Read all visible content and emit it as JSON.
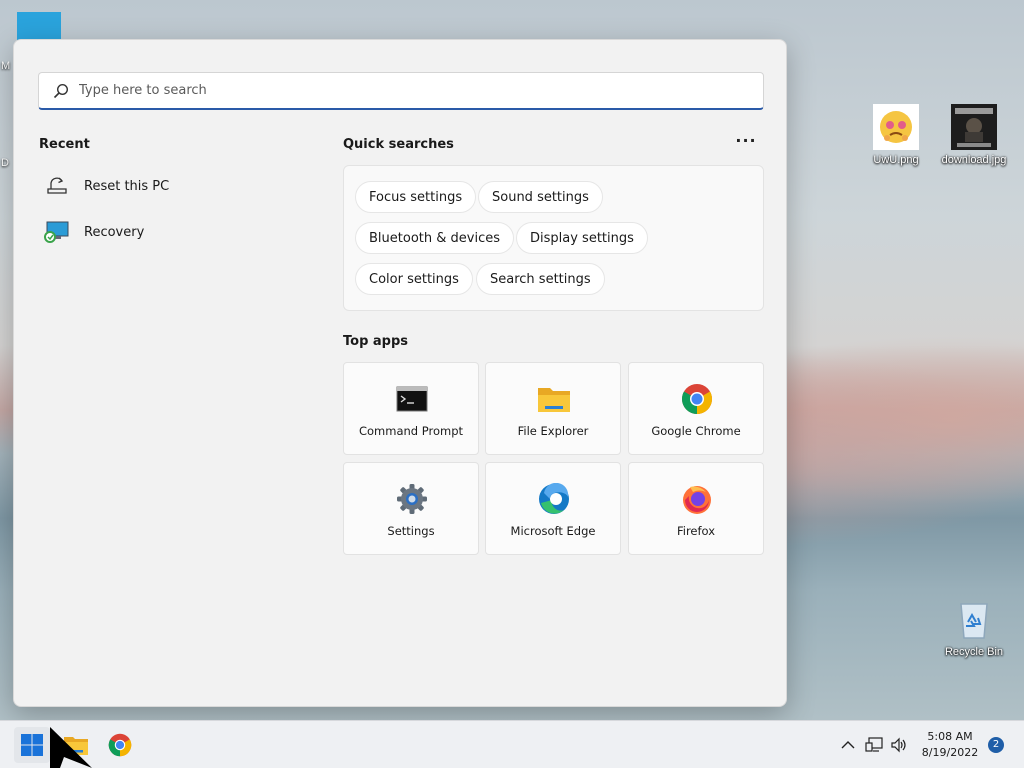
{
  "desktop": {
    "edge_labels": [
      "M",
      "D"
    ],
    "icons": [
      {
        "label": "UwU.png"
      },
      {
        "label": "download.jpg"
      },
      {
        "label": "Recycle Bin"
      }
    ]
  },
  "start_menu": {
    "search": {
      "placeholder": "Type here to search"
    },
    "recent": {
      "title": "Recent",
      "items": [
        {
          "label": "Reset this PC",
          "icon": "reset-pc-icon"
        },
        {
          "label": "Recovery",
          "icon": "recovery-icon"
        }
      ]
    },
    "quick_searches": {
      "title": "Quick searches",
      "more_label": "···",
      "chips": [
        "Focus settings",
        "Sound settings",
        "Bluetooth & devices",
        "Display settings",
        "Color settings",
        "Search settings"
      ]
    },
    "top_apps": {
      "title": "Top apps",
      "apps": [
        {
          "label": "Command Prompt",
          "icon": "command-prompt-icon"
        },
        {
          "label": "File Explorer",
          "icon": "file-explorer-icon"
        },
        {
          "label": "Google Chrome",
          "icon": "chrome-icon"
        },
        {
          "label": "Settings",
          "icon": "settings-gear-icon"
        },
        {
          "label": "Microsoft Edge",
          "icon": "edge-icon"
        },
        {
          "label": "Firefox",
          "icon": "firefox-icon"
        }
      ]
    }
  },
  "taskbar": {
    "clock": {
      "time": "5:08 AM",
      "date": "8/19/2022"
    },
    "notification_count": "2"
  },
  "colors": {
    "accent": "#2a5aa8",
    "badge": "#1f5ea8"
  }
}
